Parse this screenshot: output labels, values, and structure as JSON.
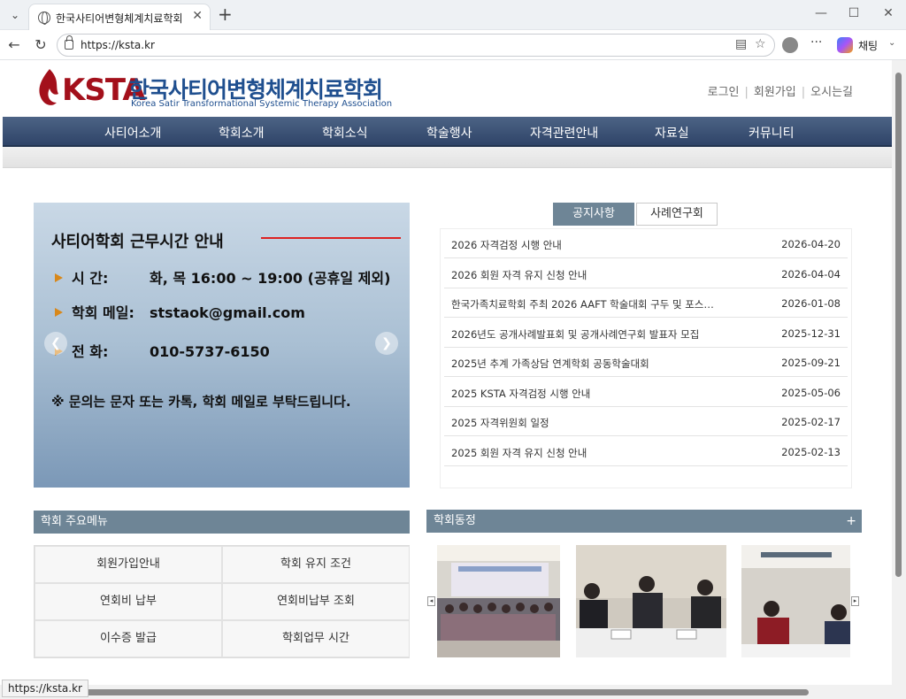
{
  "browser": {
    "tab_title": "한국사티어변형체계치료학회",
    "url": "https://ksta.kr",
    "chat_label": "채팅",
    "status_url": "https://ksta.kr"
  },
  "header": {
    "logo_abbr": "KSTA",
    "logo_korean": "한국사티어변형체계치료학회",
    "logo_english": "Korea Satir Transformational Systemic Therapy Association",
    "util_links": [
      "로그인",
      "회원가입",
      "오시는길"
    ]
  },
  "gnb": [
    "사티어소개",
    "학회소개",
    "학회소식",
    "학술행사",
    "자격관련안내",
    "자료실",
    "커뮤니티"
  ],
  "banner": {
    "title": "사티어학회 근무시간 안내",
    "rows": [
      {
        "label": "시        간:",
        "value": "화, 목 16:00 ~ 19:00 (공휴일 제외)"
      },
      {
        "label": "학회 메일:",
        "value": "ststaok@gmail.com"
      },
      {
        "label": "전        화:",
        "value": "010-5737-6150"
      }
    ],
    "note": "※ 문의는 문자 또는 카톡, 학회 메일로 부탁드립니다."
  },
  "board": {
    "tabs": [
      "공지사항",
      "사례연구회"
    ],
    "notices": [
      {
        "title": "2026 자격검정 시행 안내",
        "date": "2026-04-20"
      },
      {
        "title": "2026 회원 자격 유지 신청 안내",
        "date": "2026-04-04"
      },
      {
        "title": "한국가족치료학회 주최 2026 AAFT 학술대회 구두 및 포스터 ...",
        "date": "2026-01-08"
      },
      {
        "title": "2026년도 공개사례발표회 및 공개사례연구회 발표자 모집",
        "date": "2025-12-31"
      },
      {
        "title": "2025년 추계 가족상담 연계학회 공동학술대회",
        "date": "2025-09-21"
      },
      {
        "title": "2025 KSTA 자격검정 시행 안내",
        "date": "2025-05-06"
      },
      {
        "title": "2025 자격위원회 일정",
        "date": "2025-02-17"
      },
      {
        "title": "2025 회원 자격 유지 신청 안내",
        "date": "2025-02-13"
      }
    ]
  },
  "quick_menu": {
    "heading": "학회 주요메뉴",
    "items": [
      "회원가입안내",
      "학회 유지 조건",
      "연회비 납부",
      "연회비납부 조회",
      "이수증 발급",
      "학회업무 시간"
    ]
  },
  "news": {
    "heading": "학회동정"
  },
  "colors": {
    "brand_red": "#a3101b",
    "brand_blue": "#1f4f8f",
    "gnb": "#3a5075",
    "section_head": "#6e8596"
  }
}
